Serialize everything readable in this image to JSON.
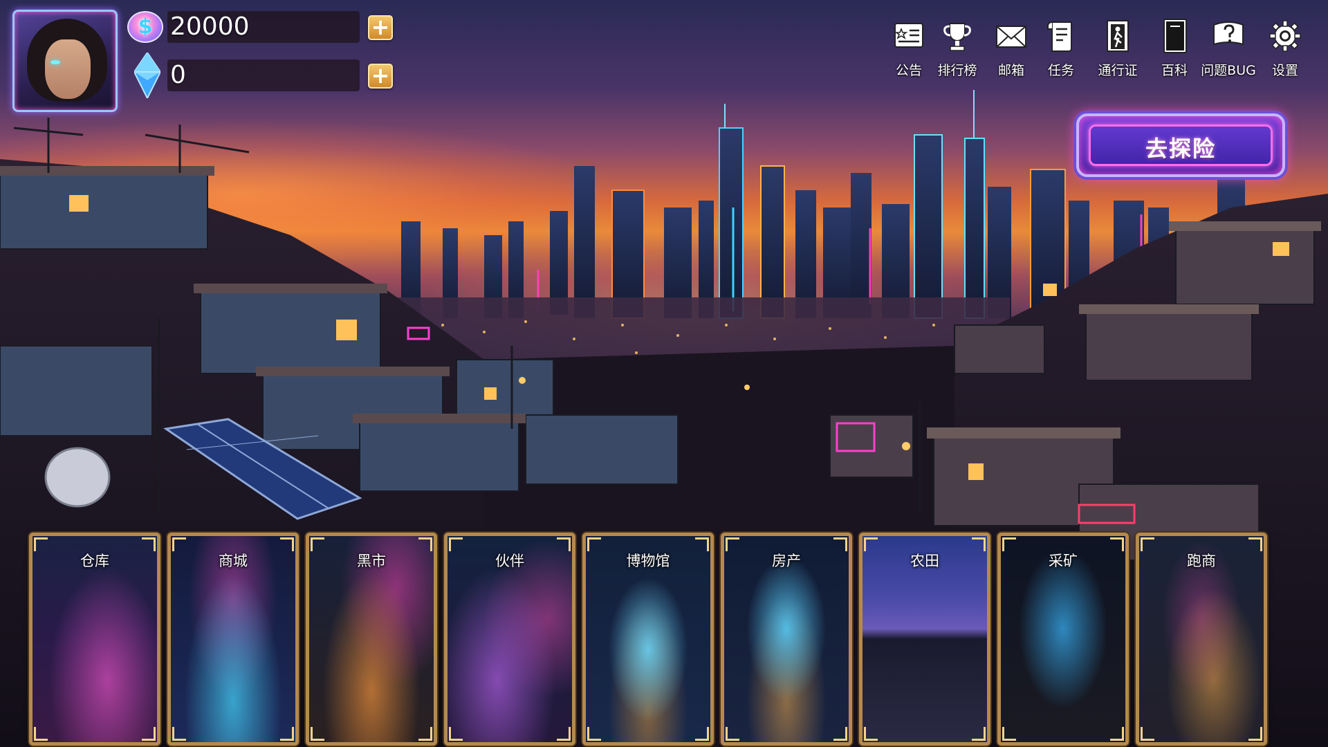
{
  "player": {
    "avatar_icon": "character-portrait",
    "gold": {
      "icon": "coin-icon",
      "symbol": "$",
      "value": "20000",
      "add_icon": "plus-icon"
    },
    "gem": {
      "icon": "diamond-icon",
      "value": "0",
      "add_icon": "plus-icon"
    }
  },
  "menu": [
    {
      "id": "announcement",
      "label": "公告",
      "icon": "notice-board-icon"
    },
    {
      "id": "leaderboard",
      "label": "排行榜",
      "icon": "trophy-icon"
    },
    {
      "id": "mailbox",
      "label": "邮箱",
      "icon": "envelope-icon"
    },
    {
      "id": "tasks",
      "label": "任务",
      "icon": "task-scroll-icon"
    },
    {
      "id": "pass",
      "label": "通行证",
      "icon": "pass-door-icon"
    },
    {
      "id": "encyclopedia",
      "label": "百科",
      "icon": "book-icon"
    },
    {
      "id": "bug",
      "label": "问题BUG",
      "icon": "question-bubble-icon"
    },
    {
      "id": "settings",
      "label": "设置",
      "icon": "gear-icon"
    }
  ],
  "explore_button": {
    "label": "去探险"
  },
  "cards": [
    {
      "id": "warehouse",
      "label": "仓库",
      "accent": "#ff5ad8"
    },
    {
      "id": "mall",
      "label": "商城",
      "accent": "#46d8ff"
    },
    {
      "id": "black-market",
      "label": "黑市",
      "accent": "#ff9a3c"
    },
    {
      "id": "partner",
      "label": "伙伴",
      "accent": "#c86bff"
    },
    {
      "id": "museum",
      "label": "博物馆",
      "accent": "#6fdcff"
    },
    {
      "id": "real-estate",
      "label": "房产",
      "accent": "#5ad2ff"
    },
    {
      "id": "farm",
      "label": "农田",
      "accent": "#7a6cff"
    },
    {
      "id": "mining",
      "label": "采矿",
      "accent": "#3ab8ff"
    },
    {
      "id": "runner",
      "label": "跑商",
      "accent": "#ffb24a"
    }
  ]
}
